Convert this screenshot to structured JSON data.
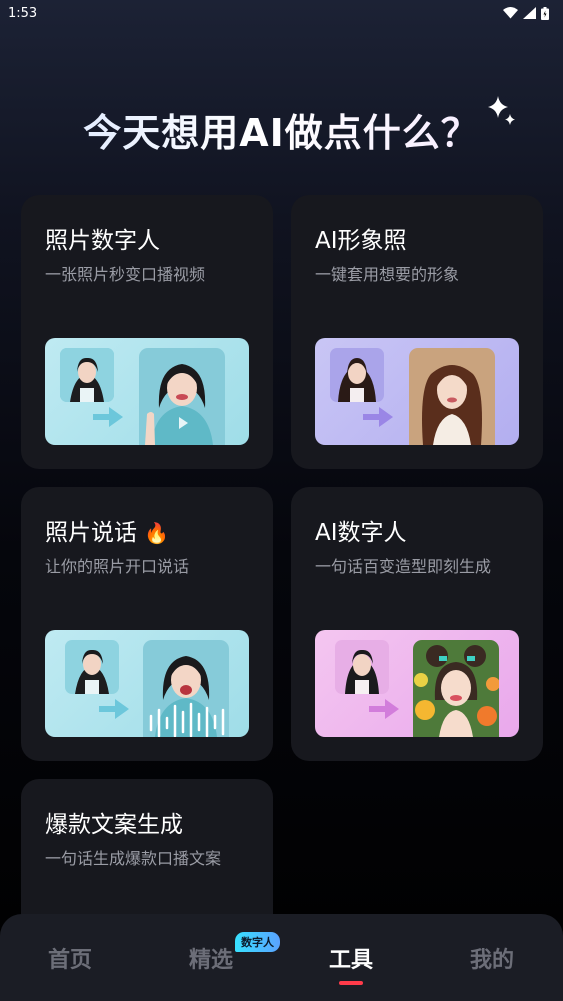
{
  "status_bar": {
    "time": "1:53"
  },
  "headline": "今天想用AI做点什么？",
  "cards": [
    {
      "title": "照片数字人",
      "subtitle": "一张照片秒变口播视频"
    },
    {
      "title": "AI形象照",
      "subtitle": "一键套用想要的形象"
    },
    {
      "title": "照片说话",
      "subtitle": "让你的照片开口说话"
    },
    {
      "title": "AI数字人",
      "subtitle": "一句话百变造型即刻生成"
    },
    {
      "title": "爆款文案生成",
      "subtitle": "一句话生成爆款口播文案"
    }
  ],
  "bottom_nav": {
    "items": [
      {
        "label": "首页"
      },
      {
        "label": "精选"
      },
      {
        "label": "工具"
      },
      {
        "label": "我的"
      }
    ],
    "badge": "数字人",
    "active": "工具"
  },
  "colors": {
    "accent_red": "#ff3b4a",
    "card_bg": "#17181e",
    "badge_cyan": "#38e1ff"
  }
}
